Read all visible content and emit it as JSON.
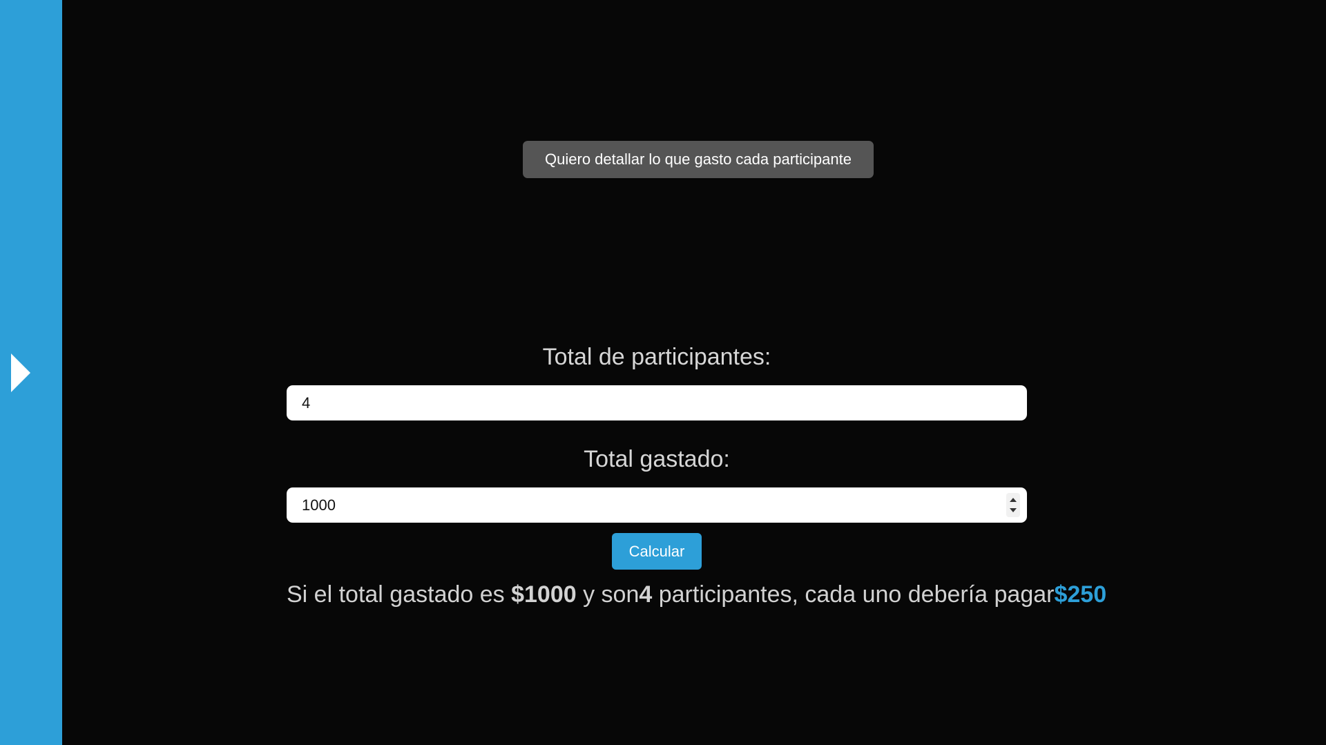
{
  "colors": {
    "accent": "#2d9fd8",
    "background": "#070707",
    "sidebar": "#2d9fd8",
    "detail_button": "#555555",
    "label_text": "#d6d6d6"
  },
  "sidebar": {
    "toggle_icon": "chevron-right-icon"
  },
  "detail_button": {
    "label": "Quiero detallar lo que gasto cada participante"
  },
  "participants": {
    "label": "Total de participantes:",
    "value": "4"
  },
  "spent": {
    "label": "Total gastado:",
    "value": "1000",
    "stepper_icons": [
      "chevron-up-icon",
      "chevron-down-icon"
    ]
  },
  "calculate_button": {
    "label": "Calcular"
  },
  "result": {
    "part1": "Si el total gastado es ",
    "total": "$1000",
    "part2": " y son",
    "participants": "4",
    "part3": " participantes, cada uno debería pagar",
    "per_person": "$250"
  }
}
